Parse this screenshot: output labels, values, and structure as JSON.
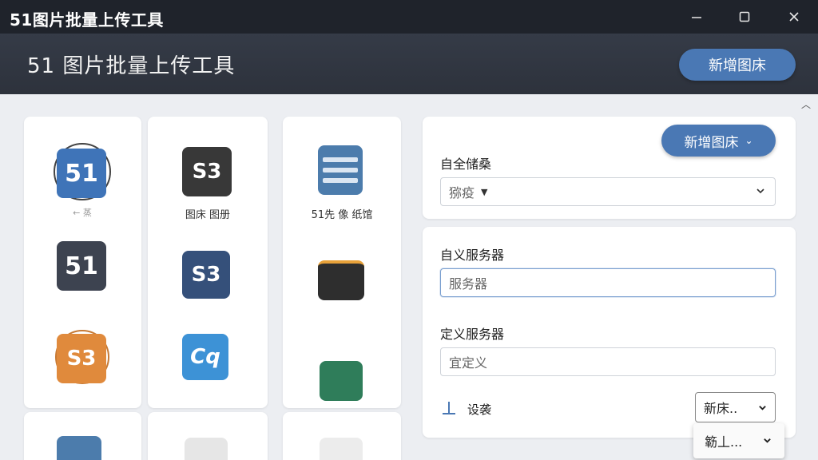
{
  "window": {
    "title": "51图片批量上传工具",
    "min": "—",
    "max": "☐",
    "close": "✕"
  },
  "header": {
    "title": "51 图片批量上传工具",
    "add_button": "新增图床"
  },
  "gallery": {
    "tiles": [
      {
        "text": "51",
        "color": "#3f74b8",
        "caption": ""
      },
      {
        "text": "S3",
        "color": "#383838",
        "caption": "图床 图册"
      },
      {
        "text": "",
        "color": "#4c7cac",
        "caption": "51先 像 纸馆"
      },
      {
        "text": "51",
        "color": "#3d4350",
        "caption": ""
      },
      {
        "text": "S3",
        "color": "#35507a",
        "caption": ""
      },
      {
        "text": "",
        "color": "#2e2e2e",
        "caption": ""
      },
      {
        "text": "S3",
        "color": "#e08a3c",
        "caption": ""
      },
      {
        "text": "Cq",
        "color": "#3d92d6",
        "caption": ""
      },
      {
        "text": "",
        "color": "#2f7d5a",
        "caption": ""
      }
    ],
    "tile0_badge": "← 蒸"
  },
  "panel1": {
    "add_button": "新增图床",
    "label": "自全储桑",
    "select_value": "猕疫"
  },
  "panel2": {
    "label1": "自义服务器",
    "input1_placeholder": "服务器",
    "label2": "定义服务器",
    "input2_placeholder": "宜定义",
    "upload_label": "设袭",
    "select_value": "新床..",
    "popup_value": "簕丄..."
  }
}
